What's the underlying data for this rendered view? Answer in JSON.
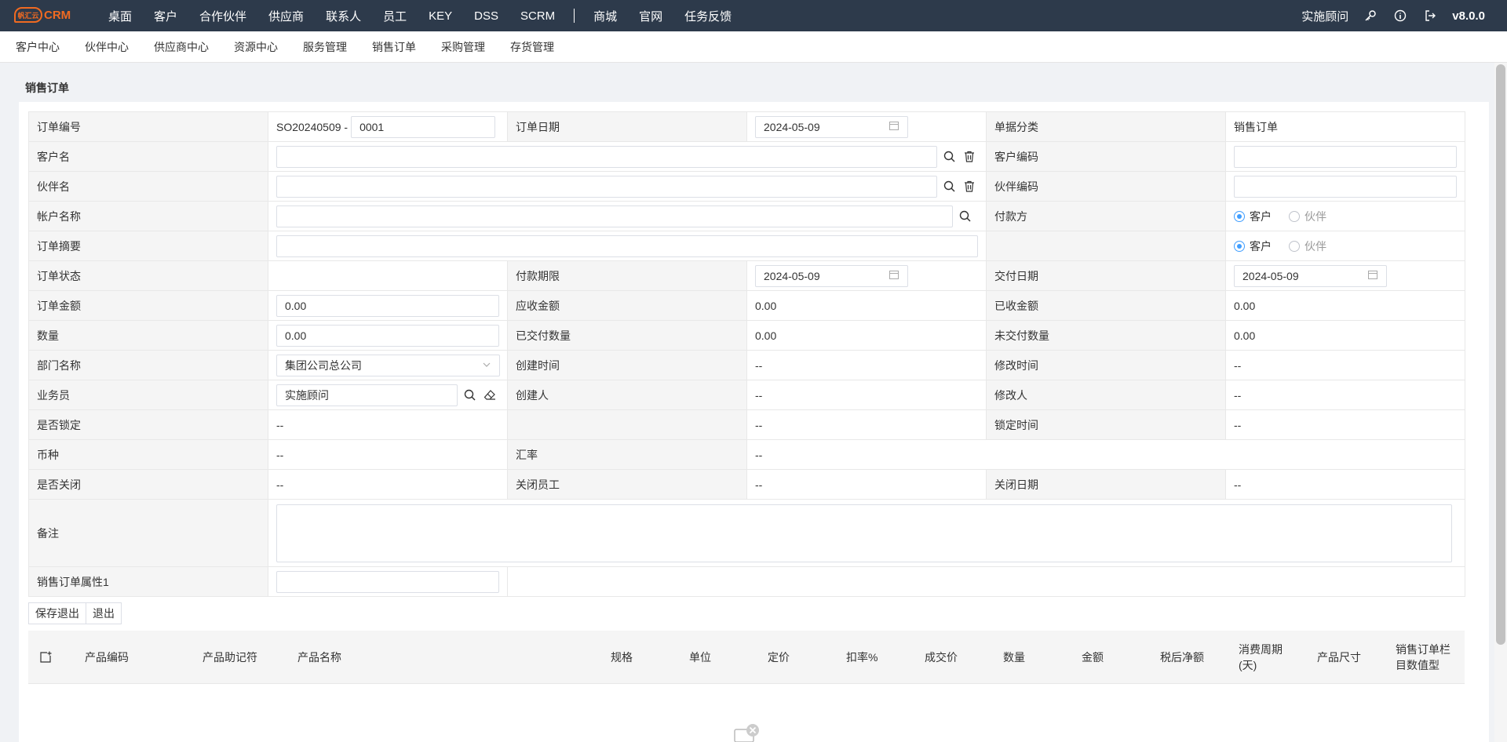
{
  "app": {
    "logo_badge": "帆汇云",
    "logo_text": "CRM"
  },
  "topnav": {
    "items": [
      "桌面",
      "客户",
      "合作伙伴",
      "供应商",
      "联系人",
      "员工",
      "KEY",
      "DSS",
      "SCRM"
    ],
    "items2": [
      "商城",
      "官网",
      "任务反馈"
    ],
    "user": "实施顾问",
    "version": "v8.0.0"
  },
  "subnav": {
    "items": [
      "客户中心",
      "伙伴中心",
      "供应商中心",
      "资源中心",
      "服务管理",
      "销售订单",
      "采购管理",
      "存货管理"
    ]
  },
  "page": {
    "title": "销售订单"
  },
  "form": {
    "order_no_label": "订单编号",
    "order_no_prefix": "SO20240509 -",
    "order_no_suffix": "0001",
    "order_date_label": "订单日期",
    "order_date": "2024-05-09",
    "doc_type_label": "单据分类",
    "doc_type": "销售订单",
    "customer_name_label": "客户名",
    "customer_code_label": "客户编码",
    "partner_name_label": "伙伴名",
    "partner_code_label": "伙伴编码",
    "account_name_label": "帐户名称",
    "payer_label": "付款方",
    "radio_customer": "客户",
    "radio_partner": "伙伴",
    "summary_label": "订单摘要",
    "status_label": "订单状态",
    "payment_term_label": "付款期限",
    "payment_term": "2024-05-09",
    "delivery_date_label": "交付日期",
    "delivery_date": "2024-05-09",
    "amount_label": "订单金额",
    "amount": "0.00",
    "receivable_label": "应收金额",
    "receivable": "0.00",
    "received_label": "已收金额",
    "received": "0.00",
    "qty_label": "数量",
    "qty": "0.00",
    "delivered_qty_label": "已交付数量",
    "delivered_qty": "0.00",
    "undelivered_qty_label": "未交付数量",
    "undelivered_qty": "0.00",
    "dept_label": "部门名称",
    "dept": "集团公司总公司",
    "created_time_label": "创建时间",
    "created_time": "--",
    "modified_time_label": "修改时间",
    "modified_time": "--",
    "salesman_label": "业务员",
    "salesman": "实施顾问",
    "creator_label": "创建人",
    "creator": "--",
    "modifier_label": "修改人",
    "modifier": "--",
    "locked_label": "是否锁定",
    "locked": "--",
    "lock_blank_value": "--",
    "lock_time_label": "锁定时间",
    "lock_time": "--",
    "currency_label": "币种",
    "currency": "--",
    "rate_label": "汇率",
    "rate": "--",
    "closed_label": "是否关闭",
    "closed": "--",
    "close_staff_label": "关闭员工",
    "close_staff": "--",
    "close_date_label": "关闭日期",
    "close_date": "--",
    "remark_label": "备注",
    "attr1_label": "销售订单属性1"
  },
  "buttons": {
    "save_exit": "保存退出",
    "exit": "退出"
  },
  "grid": {
    "columns": [
      "产品编码",
      "产品助记符",
      "产品名称",
      "规格",
      "单位",
      "定价",
      "扣率%",
      "成交价",
      "数量",
      "金额",
      "税后净额",
      "消费周期(天)",
      "产品尺寸",
      "销售订单栏目数值型"
    ]
  },
  "colors": {
    "topnav_bg": "#2d3a4b",
    "brand": "#f06a21",
    "accent": "#409eff",
    "label_bg": "#f5f5f5"
  }
}
